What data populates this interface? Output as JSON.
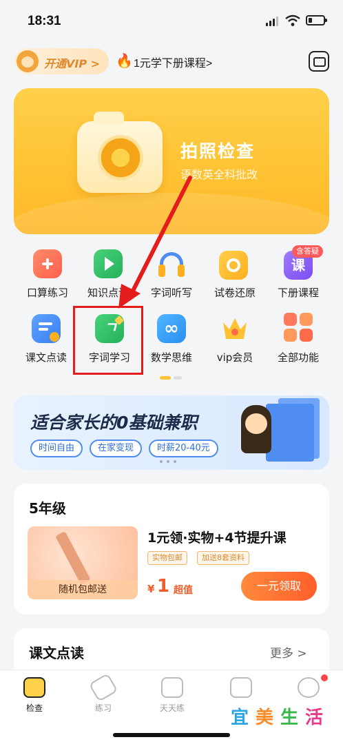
{
  "status_bar": {
    "time": "18:31"
  },
  "header": {
    "vip_label": "开通VIP >",
    "promo_text": "1元学下册课程>"
  },
  "hero": {
    "title": "拍照检查",
    "subtitle": "语数英全科批改"
  },
  "tools_row1": [
    {
      "label": "口算练习",
      "icon": "calc-practice-icon",
      "color": "#ff7a5c"
    },
    {
      "label": "知识点讲",
      "icon": "video-play-icon",
      "color": "#36c46a"
    },
    {
      "label": "字词听写",
      "icon": "headphones-icon",
      "color": "#4f8ef0"
    },
    {
      "label": "试卷还原",
      "icon": "camera-restore-icon",
      "color": "#ffb020"
    },
    {
      "label": "下册课程",
      "icon": "course-icon",
      "color": "#8e5cf0",
      "badge": "含答疑",
      "icon_text": "课"
    }
  ],
  "tools_row2": [
    {
      "label": "课文点读",
      "icon": "text-read-icon",
      "color": "#4f8ef0"
    },
    {
      "label": "字词学习",
      "icon": "pen-learn-icon",
      "color": "#36c46a"
    },
    {
      "label": "数学思维",
      "icon": "infinity-icon",
      "color": "#3fa5f5"
    },
    {
      "label": "vip会员",
      "icon": "crown-icon",
      "color": "#ffb020"
    },
    {
      "label": "全部功能",
      "icon": "grid-all-icon",
      "color": "#ff6b4a"
    }
  ],
  "banner": {
    "title": "适合家长的0基础兼职",
    "tags": [
      "时间自由",
      "在家变现",
      "时薪20-40元"
    ]
  },
  "grade_card": {
    "title": "5年级",
    "product_name": "1元领·实物+4节提升课",
    "tags": [
      "实物包邮",
      "加送8套资料"
    ],
    "image_caption": "随机包邮送",
    "price_symbol": "¥",
    "price": "1",
    "price_note": "超值",
    "claim_button": "一元领取"
  },
  "read_card": {
    "title": "课文点读",
    "more": "更多 >"
  },
  "tabbar": [
    {
      "label": "检查",
      "icon": "camera-tab-icon",
      "active": true
    },
    {
      "label": "练习",
      "icon": "eraser-tab-icon",
      "active": false
    },
    {
      "label": "天天练",
      "icon": "checkbox-tab-icon",
      "active": false
    },
    {
      "label": "班级",
      "icon": "class-tab-icon",
      "active": false
    },
    {
      "label": "我",
      "icon": "profile-tab-icon",
      "active": false
    }
  ],
  "watermark": [
    "宜",
    "美",
    "生",
    "活"
  ],
  "colors": {
    "accent_yellow": "#ffc233",
    "highlight_red": "#e51c1c",
    "price_orange": "#f25c2a",
    "banner_blue": "#4f8ef0"
  }
}
